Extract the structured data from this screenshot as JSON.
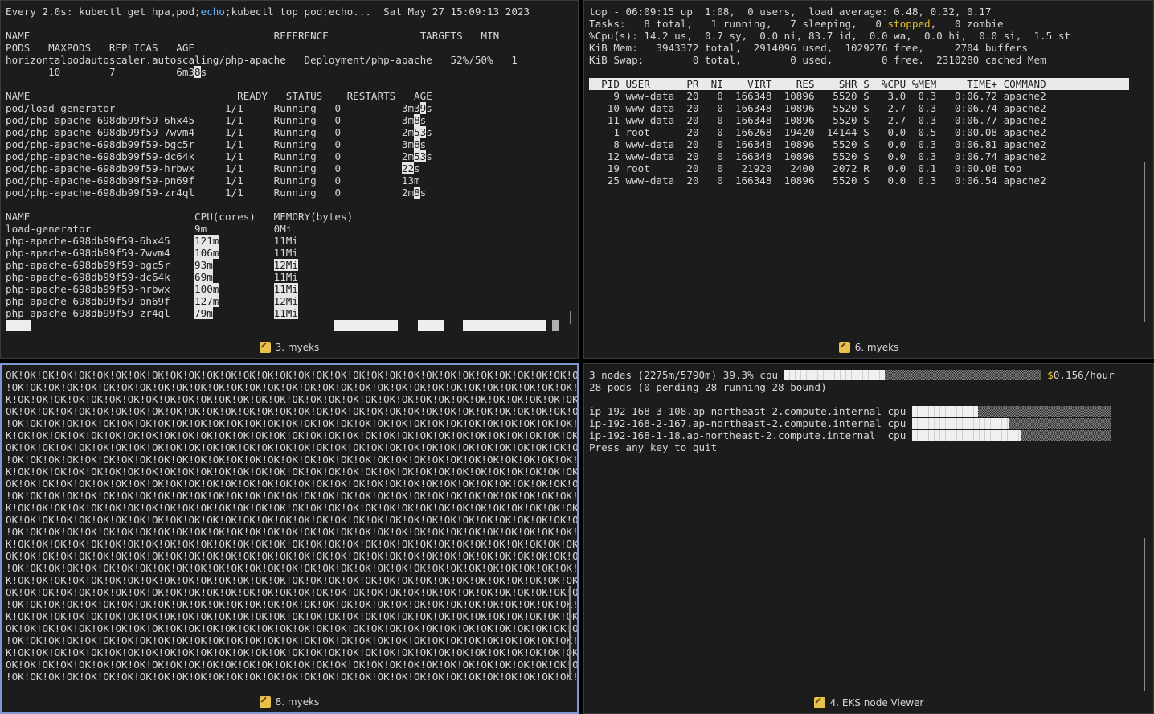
{
  "pane_watch": {
    "title": "3. myeks",
    "header_cmd": "Every 2.0s: kubectl get hpa,pod;",
    "header_echo": "echo",
    "header_rest": ";kubectl top pod;echo...",
    "header_time": "Sat May 27 15:09:13 2023",
    "hpa_header": "NAME                                        REFERENCE               TARGETS   MIN",
    "hpa_header2": "PODS   MAXPODS   REPLICAS   AGE",
    "hpa_row": "horizontalpodautoscaler.autoscaling/php-apache   Deployment/php-apache   52%/50%   1",
    "hpa_row2_a": "       10        7          6m3",
    "hpa_row2_b": "8",
    "hpa_row2_c": "s",
    "pod_header": "NAME                                  READY   STATUS    RESTARTS   AGE",
    "pods": [
      {
        "name": "pod/load-generator                  ",
        "ready": "1/1",
        "status": "Running",
        "restarts": "0",
        "age_a": "3m3",
        "age_b": "9",
        "age_c": "s"
      },
      {
        "name": "pod/php-apache-698db99f59-6hx45     ",
        "ready": "1/1",
        "status": "Running",
        "restarts": "0",
        "age_a": "3m",
        "age_b": "8",
        "age_c": "s"
      },
      {
        "name": "pod/php-apache-698db99f59-7wvm4     ",
        "ready": "1/1",
        "status": "Running",
        "restarts": "0",
        "age_a": "2m",
        "age_b": "53",
        "age_c": "s"
      },
      {
        "name": "pod/php-apache-698db99f59-bgc5r     ",
        "ready": "1/1",
        "status": "Running",
        "restarts": "0",
        "age_a": "3m",
        "age_b": "8",
        "age_c": "s"
      },
      {
        "name": "pod/php-apache-698db99f59-dc64k     ",
        "ready": "1/1",
        "status": "Running",
        "restarts": "0",
        "age_a": "2m",
        "age_b": "53",
        "age_c": "s"
      },
      {
        "name": "pod/php-apache-698db99f59-hrbwx     ",
        "ready": "1/1",
        "status": "Running",
        "restarts": "0",
        "age_a": "",
        "age_b": "22",
        "age_c": "s"
      },
      {
        "name": "pod/php-apache-698db99f59-pn69f     ",
        "ready": "1/1",
        "status": "Running",
        "restarts": "0",
        "age_a": "13m",
        "age_b": "",
        "age_c": ""
      },
      {
        "name": "pod/php-apache-698db99f59-zr4ql     ",
        "ready": "1/1",
        "status": "Running",
        "restarts": "0",
        "age_a": "2m",
        "age_b": "8",
        "age_c": "s"
      }
    ],
    "top_header": "NAME                           CPU(cores)   MEMORY(bytes)",
    "top_rows": [
      {
        "name": "load-generator                 ",
        "cpu": "9m",
        "mem": "0Mi"
      },
      {
        "name": "php-apache-698db99f59-6hx45    ",
        "cpu": "121m",
        "mem": "11Mi"
      },
      {
        "name": "php-apache-698db99f59-7wvm4    ",
        "cpu": "106m",
        "mem": "11Mi"
      },
      {
        "name": "php-apache-698db99f59-bgc5r    ",
        "cpu": "93m",
        "mem": "12Mi"
      },
      {
        "name": "php-apache-698db99f59-dc64k    ",
        "cpu": "69m",
        "mem": "11Mi"
      },
      {
        "name": "php-apache-698db99f59-hrbwx    ",
        "cpu": "100m",
        "mem": "11Mi"
      },
      {
        "name": "php-apache-698db99f59-pn69f    ",
        "cpu": "127m",
        "mem": "12Mi"
      },
      {
        "name": "php-apache-698db99f59-zr4ql    ",
        "cpu": "79m",
        "mem": "11Mi"
      }
    ]
  },
  "pane_top": {
    "title": "6. myeks",
    "l1": "top - 06:09:15 up  1:08,  0 users,  load average: 0.48, 0.32, 0.17",
    "l2a": "Tasks:   8 total,   1 running,   7 sleeping,   0 ",
    "l2b": "stopped",
    "l2c": ",   0 zombie",
    "l3": "%Cpu(s): 14.2 us,  0.7 sy,  0.0 ni, 83.7 id,  0.0 wa,  0.0 hi,  0.0 si,  1.5 st",
    "l4": "KiB Mem:   3943372 total,  2914096 used,  1029276 free,     2704 buffers",
    "l5": "KiB Swap:        0 total,        0 used,        0 free.  2310280 cached Mem",
    "header": "  PID USER      PR  NI    VIRT    RES    SHR S  %CPU %MEM     TIME+ COMMAND        ",
    "procs": [
      "    9 www-data  20   0  166348  10896   5520 S   3.0  0.3   0:06.72 apache2",
      "   10 www-data  20   0  166348  10896   5520 S   2.7  0.3   0:06.74 apache2",
      "   11 www-data  20   0  166348  10896   5520 S   2.7  0.3   0:06.77 apache2",
      "    1 root      20   0  166268  19420  14144 S   0.0  0.5   0:00.08 apache2",
      "    8 www-data  20   0  166348  10896   5520 S   0.0  0.3   0:06.81 apache2",
      "   12 www-data  20   0  166348  10896   5520 S   0.0  0.3   0:06.74 apache2",
      "   19 root      20   0   21920   2400   2072 R   0.0  0.1   0:00.08 top",
      "   25 www-data  20   0  166348  10896   5520 S   0.0  0.3   0:06.54 apache2"
    ]
  },
  "pane_ok": {
    "title": "8. myeks",
    "lines": [
      "OK!OK!OK!OK!OK!OK!OK!OK!OK!OK!OK!OK!OK!OK!OK!OK!OK!OK!OK!OK!OK!OK!OK!OK!OK!OK!OK!OK!OK!OK!OK!OK",
      "!OK!OK!OK!OK!OK!OK!OK!OK!OK!OK!OK!OK!OK!OK!OK!OK!OK!OK!OK!OK!OK!OK!OK!OK!OK!OK!OK!OK!OK!OK!OK!O",
      "K!OK!OK!OK!OK!OK!OK!OK!OK!OK!OK!OK!OK!OK!OK!OK!OK!OK!OK!OK!OK!OK!OK!OK!OK!OK!OK!OK!OK!OK!OK!OK!",
      "OK!OK!OK!OK!OK!OK!OK!OK!OK!OK!OK!OK!OK!OK!OK!OK!OK!OK!OK!OK!OK!OK!OK!OK!OK!OK!OK!OK!OK!OK!OK!OK",
      "!OK!OK!OK!OK!OK!OK!OK!OK!OK!OK!OK!OK!OK!OK!OK!OK!OK!OK!OK!OK!OK!OK!OK!OK!OK!OK!OK!OK!OK!OK!OK!O",
      "K!OK!OK!OK!OK!OK!OK!OK!OK!OK!OK!OK!OK!OK!OK!OK!OK!OK!OK!OK!OK!OK!OK!OK!OK!OK!OK!OK!OK!OK!OK!OK!",
      "OK!OK!OK!OK!OK!OK!OK!OK!OK!OK!OK!OK!OK!OK!OK!OK!OK!OK!OK!OK!OK!OK!OK!OK!OK!OK!OK!OK!OK!OK!OK!OK",
      "!OK!OK!OK!OK!OK!OK!OK!OK!OK!OK!OK!OK!OK!OK!OK!OK!OK!OK!OK!OK!OK!OK!OK!OK!OK!OK!OK!OK!OK!OK!OK!O",
      "K!OK!OK!OK!OK!OK!OK!OK!OK!OK!OK!OK!OK!OK!OK!OK!OK!OK!OK!OK!OK!OK!OK!OK!OK!OK!OK!OK!OK!OK!OK!OK!",
      "OK!OK!OK!OK!OK!OK!OK!OK!OK!OK!OK!OK!OK!OK!OK!OK!OK!OK!OK!OK!OK!OK!OK!OK!OK!OK!OK!OK!OK!OK!OK!OK",
      "!OK!OK!OK!OK!OK!OK!OK!OK!OK!OK!OK!OK!OK!OK!OK!OK!OK!OK!OK!OK!OK!OK!OK!OK!OK!OK!OK!OK!OK!OK!OK!O",
      "K!OK!OK!OK!OK!OK!OK!OK!OK!OK!OK!OK!OK!OK!OK!OK!OK!OK!OK!OK!OK!OK!OK!OK!OK!OK!OK!OK!OK!OK!OK!OK!",
      "OK!OK!OK!OK!OK!OK!OK!OK!OK!OK!OK!OK!OK!OK!OK!OK!OK!OK!OK!OK!OK!OK!OK!OK!OK!OK!OK!OK!OK!OK!OK!OK",
      "!OK!OK!OK!OK!OK!OK!OK!OK!OK!OK!OK!OK!OK!OK!OK!OK!OK!OK!OK!OK!OK!OK!OK!OK!OK!OK!OK!OK!OK!OK!OK!O",
      "K!OK!OK!OK!OK!OK!OK!OK!OK!OK!OK!OK!OK!OK!OK!OK!OK!OK!OK!OK!OK!OK!OK!OK!OK!OK!OK!OK!OK!OK!OK!OK!",
      "OK!OK!OK!OK!OK!OK!OK!OK!OK!OK!OK!OK!OK!OK!OK!OK!OK!OK!OK!OK!OK!OK!OK!OK!OK!OK!OK!OK!OK!OK!OK!OK",
      "!OK!OK!OK!OK!OK!OK!OK!OK!OK!OK!OK!OK!OK!OK!OK!OK!OK!OK!OK!OK!OK!OK!OK!OK!OK!OK!OK!OK!OK!OK!OK!O",
      "K!OK!OK!OK!OK!OK!OK!OK!OK!OK!OK!OK!OK!OK!OK!OK!OK!OK!OK!OK!OK!OK!OK!OK!OK!OK!OK!OK!OK!OK!OK!OK!",
      "OK!OK!OK!OK!OK!OK!OK!OK!OK!OK!OK!OK!OK!OK!OK!OK!OK!OK!OK!OK!OK!OK!OK!OK!OK!OK!OK!OK!OK!OK!OK!OK",
      "!OK!OK!OK!OK!OK!OK!OK!OK!OK!OK!OK!OK!OK!OK!OK!OK!OK!OK!OK!OK!OK!OK!OK!OK!OK!OK!OK!OK!OK!OK!OK!O",
      "K!OK!OK!OK!OK!OK!OK!OK!OK!OK!OK!OK!OK!OK!OK!OK!OK!OK!OK!OK!OK!OK!OK!OK!OK!OK!OK!OK!OK!OK!OK!OK!",
      "OK!OK!OK!OK!OK!OK!OK!OK!OK!OK!OK!OK!OK!OK!OK!OK!OK!OK!OK!OK!OK!OK!OK!OK!OK!OK!OK!OK!OK!OK!OK!OK",
      "!OK!OK!OK!OK!OK!OK!OK!OK!OK!OK!OK!OK!OK!OK!OK!OK!OK!OK!OK!OK!OK!OK!OK!OK!OK!OK!OK!OK!OK!OK!OK!O",
      "K!OK!OK!OK!OK!OK!OK!OK!OK!OK!OK!OK!OK!OK!OK!OK!OK!OK!OK!OK!OK!OK!OK!OK!OK!OK!OK!OK!OK!OK!OK!OK!",
      "OK!OK!OK!OK!OK!OK!OK!OK!OK!OK!OK!OK!OK!OK!OK!OK!OK!OK!OK!OK!OK!OK!OK!OK!OK!OK!OK!OK!OK!OK!OK!OK"
    ],
    "last_line": "!OK!OK!OK!OK!OK!OK!OK!OK!OK!OK!OK!OK!OK!OK!OK!OK!OK!OK!OK!OK!OK!OK!OK!OK!OK!OK!OK!OK!OK!OK!OK!"
  },
  "pane_nodes": {
    "title": "4. EKS node Viewer",
    "summary_a": "3 nodes (2275m/5790m) 39.3% cpu ",
    "cost_dollar": "$",
    "cost_rest": "0.156/hour",
    "summary2": "28 pods (0 pending 28 running 28 bound)",
    "nodes": [
      {
        "name": "ip-192-168-3-108.ap-northeast-2.compute.internal",
        "label": "cpu",
        "fill": 0.33
      },
      {
        "name": "ip-192-168-2-167.ap-northeast-2.compute.internal",
        "label": "cpu",
        "fill": 0.49
      },
      {
        "name": "ip-192-168-1-18.ap-northeast-2.compute.internal ",
        "label": "cpu",
        "fill": 0.55
      }
    ],
    "summary_fill": 0.393,
    "quit": "Press any key to quit"
  },
  "colors": {
    "accent_border": "#7f99cf",
    "echo": "#5fb3ff",
    "stopped": "#e6c229",
    "cost": "#e6c229"
  }
}
